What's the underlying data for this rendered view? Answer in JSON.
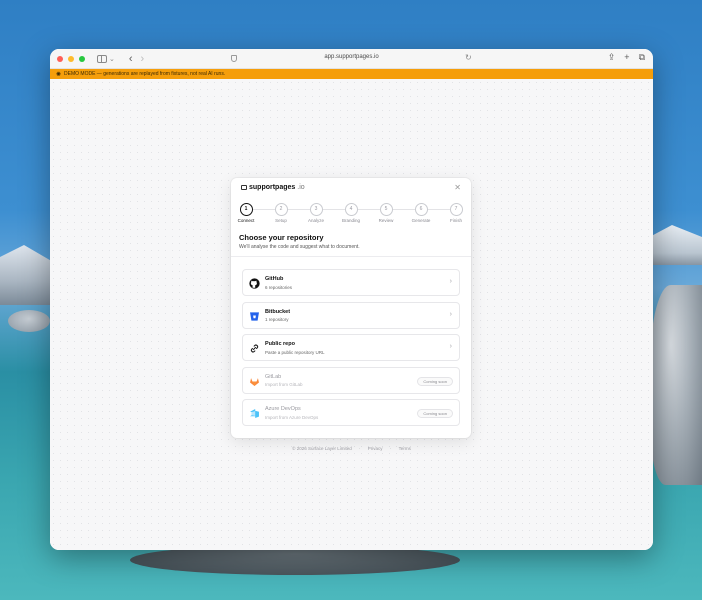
{
  "browser": {
    "url": "app.supportpages.io"
  },
  "banner": {
    "text": "DEMO MODE — generations are replayed from fixtures, not real AI runs."
  },
  "modal": {
    "brand_name": "supportpages",
    "brand_tld": ".io",
    "heading": "Choose your repository",
    "subheading": "We'll analyse the code and suggest what to document.",
    "steps": [
      {
        "number": "1",
        "label": "Connect"
      },
      {
        "number": "2",
        "label": "Setup"
      },
      {
        "number": "3",
        "label": "Analyze"
      },
      {
        "number": "4",
        "label": "Branding"
      },
      {
        "number": "5",
        "label": "Review"
      },
      {
        "number": "6",
        "label": "Generate"
      },
      {
        "number": "7",
        "label": "Finish"
      }
    ],
    "active_step": 1,
    "providers": [
      {
        "title": "GitHub",
        "subtitle": "6 repositories",
        "icon": "github-icon",
        "enabled": true
      },
      {
        "title": "Bitbucket",
        "subtitle": "1 repository",
        "icon": "bitbucket-icon",
        "enabled": true
      },
      {
        "title": "Public repo",
        "subtitle": "Paste a public repository URL",
        "icon": "link-icon",
        "enabled": true
      },
      {
        "title": "GitLab",
        "subtitle": "Import from GitLab",
        "icon": "gitlab-icon",
        "enabled": false,
        "badge": "Coming soon"
      },
      {
        "title": "Azure DevOps",
        "subtitle": "Import from Azure DevOps",
        "icon": "azure-devops-icon",
        "enabled": false,
        "badge": "Coming soon"
      }
    ]
  },
  "footer": {
    "copyright": "© 2026 Surface Layer Limited",
    "separator": "·",
    "privacy": "Privacy",
    "terms": "Terms"
  },
  "colors": {
    "banner": "#f59e0b",
    "github": "#111111",
    "bitbucket": "#2563eb",
    "gitlab": "#f97316",
    "azure": "#0ea5e9"
  }
}
